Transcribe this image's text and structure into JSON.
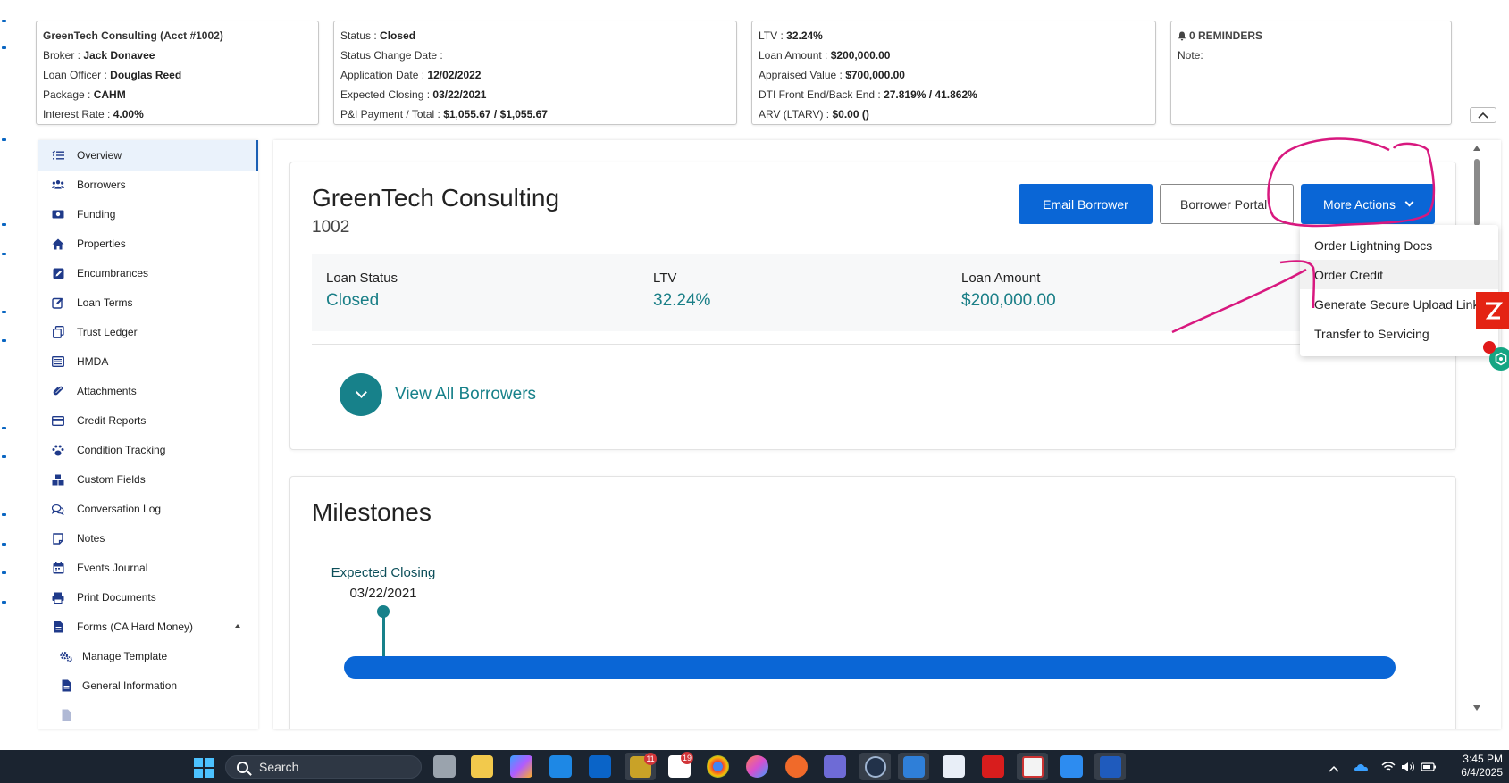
{
  "header": {
    "account": {
      "title": "GreenTech Consulting (Acct #1002)",
      "broker_label": "Broker :",
      "broker": "Jack Donavee",
      "loan_officer_label": "Loan Officer :",
      "loan_officer": "Douglas Reed",
      "package_label": "Package :",
      "package": "CAHM",
      "interest_rate_label": "Interest Rate :",
      "interest_rate": "4.00%"
    },
    "status": {
      "status_label": "Status :",
      "status": "Closed",
      "status_change_label": "Status Change Date :",
      "status_change": "",
      "application_date_label": "Application Date :",
      "application_date": "12/02/2022",
      "expected_closing_label": "Expected Closing :",
      "expected_closing": "03/22/2021",
      "pi_payment_label": "P&I Payment / Total :",
      "pi_payment": "$1,055.67 / $1,055.67"
    },
    "loan": {
      "ltv_label": "LTV :",
      "ltv": "32.24%",
      "loan_amount_label": "Loan Amount :",
      "loan_amount": "$200,000.00",
      "appraised_label": "Appraised Value :",
      "appraised": "$700,000.00",
      "dti_label": "DTI Front End/Back End :",
      "dti": "27.819% / 41.862%",
      "arv_label": "ARV (LTARV) :",
      "arv": "$0.00 ()"
    },
    "reminders": {
      "title": "0 REMINDERS",
      "note_label": "Note:"
    }
  },
  "sidebar": {
    "items": [
      {
        "label": "Overview",
        "icon": "list-check-icon"
      },
      {
        "label": "Borrowers",
        "icon": "users-icon"
      },
      {
        "label": "Funding",
        "icon": "money-bill-icon"
      },
      {
        "label": "Properties",
        "icon": "home-icon"
      },
      {
        "label": "Encumbrances",
        "icon": "edit-square-icon"
      },
      {
        "label": "Loan Terms",
        "icon": "pencil-square-icon"
      },
      {
        "label": "Trust Ledger",
        "icon": "copy-icon"
      },
      {
        "label": "HMDA",
        "icon": "list-alt-icon"
      },
      {
        "label": "Attachments",
        "icon": "paperclip-icon"
      },
      {
        "label": "Credit Reports",
        "icon": "credit-card-icon"
      },
      {
        "label": "Condition Tracking",
        "icon": "paw-icon"
      },
      {
        "label": "Custom Fields",
        "icon": "cubes-icon"
      },
      {
        "label": "Conversation Log",
        "icon": "comments-icon"
      },
      {
        "label": "Notes",
        "icon": "sticky-note-icon"
      },
      {
        "label": "Events Journal",
        "icon": "calendar-icon"
      },
      {
        "label": "Print Documents",
        "icon": "print-icon"
      },
      {
        "label": "Forms (CA Hard Money)",
        "icon": "file-icon"
      },
      {
        "label": "Manage Template",
        "icon": "cogs-icon"
      },
      {
        "label": "General Information",
        "icon": "file-text-icon"
      }
    ]
  },
  "overview": {
    "borrower_name": "GreenTech Consulting",
    "account_number": "1002",
    "email_button": "Email Borrower",
    "portal_button": "Borrower Portal",
    "more_actions_button": "More Actions",
    "stats": [
      {
        "label": "Loan Status",
        "value": "Closed"
      },
      {
        "label": "LTV",
        "value": "32.24%"
      },
      {
        "label": "Loan Amount",
        "value": "$200,000.00"
      }
    ],
    "view_all_borrowers": "View All Borrowers"
  },
  "dropdown": {
    "items": [
      "Order Lightning Docs",
      "Order Credit",
      "Generate Secure Upload Link",
      "Transfer to Servicing"
    ]
  },
  "milestones": {
    "title": "Milestones",
    "label": "Expected Closing",
    "date": "03/22/2021"
  },
  "taskbar": {
    "search_placeholder": "Search",
    "time": "3:45 PM",
    "date": "6/4/2025",
    "badge_8x8": "11",
    "badge_slack": "19"
  },
  "colors": {
    "primary": "#0a66d6",
    "teal": "#17818a",
    "annotation": "#d8187f"
  }
}
